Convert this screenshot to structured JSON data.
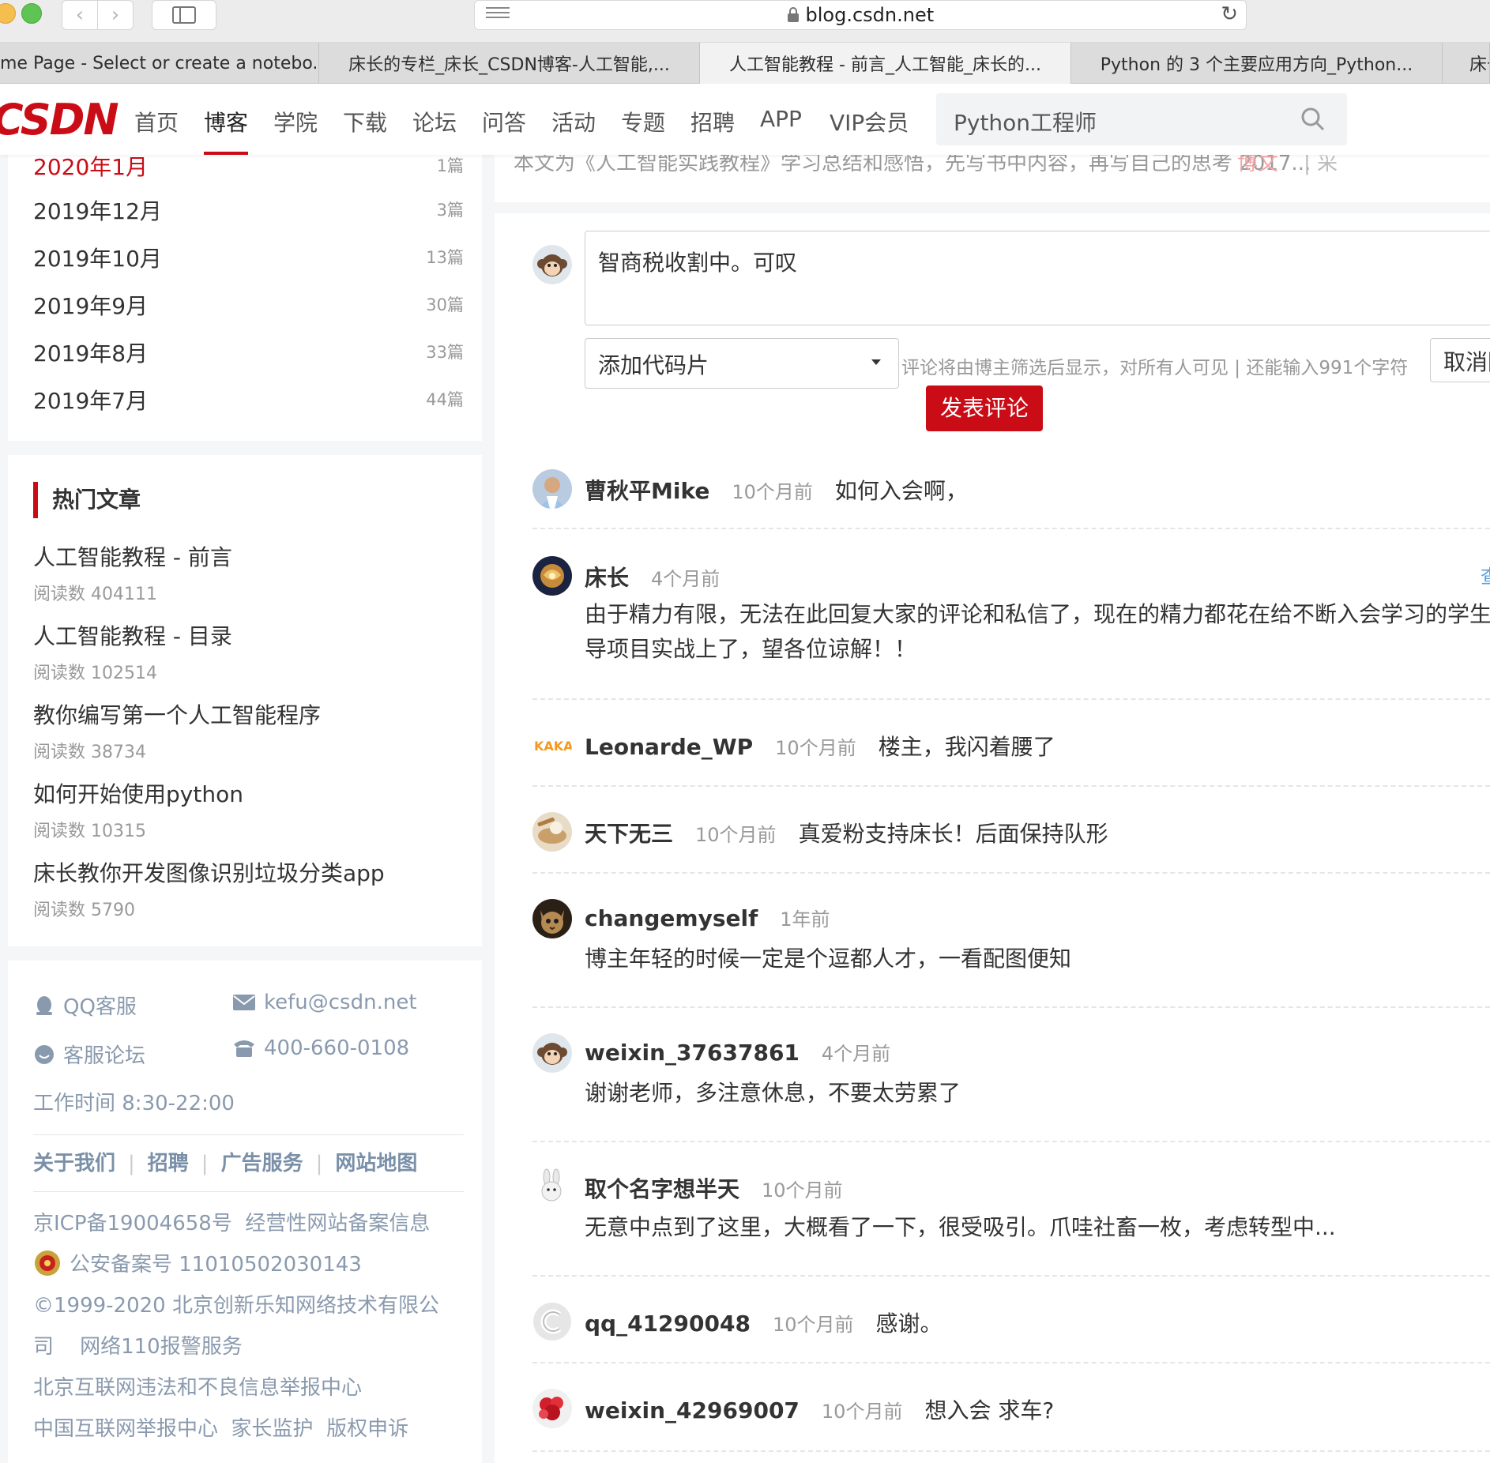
{
  "browser": {
    "url": "blog.csdn.net",
    "tabs": [
      "me Page - Select or create a notebo...",
      "床长的专栏_床长_CSDN博客-人工智能,...",
      "人工智能教程 - 前言_人工智能_床长的...",
      "Python 的 3 个主要应用方向_Python...",
      "床长"
    ]
  },
  "header": {
    "logo": "CSDN",
    "nav": [
      "首页",
      "博客",
      "学院",
      "下载",
      "论坛",
      "问答",
      "活动",
      "专题",
      "招聘",
      "APP",
      "VIP会员"
    ],
    "active_nav": "博客",
    "search_value": "Python工程师"
  },
  "archive": [
    {
      "month": "2020年1月",
      "count": "1篇"
    },
    {
      "month": "2019年12月",
      "count": "3篇"
    },
    {
      "month": "2019年10月",
      "count": "13篇"
    },
    {
      "month": "2019年9月",
      "count": "30篇"
    },
    {
      "month": "2019年8月",
      "count": "33篇"
    },
    {
      "month": "2019年7月",
      "count": "44篇"
    }
  ],
  "hot": {
    "title": "热门文章",
    "items": [
      {
        "title": "人工智能教程 - 前言",
        "reads": "阅读数 404111"
      },
      {
        "title": "人工智能教程 - 目录",
        "reads": "阅读数 102514"
      },
      {
        "title": "教你编写第一个人工智能程序",
        "reads": "阅读数 38734"
      },
      {
        "title": "如何开始使用python",
        "reads": "阅读数 10315"
      },
      {
        "title": "床长教你开发图像识别垃圾分类app",
        "reads": "阅读数 5790"
      }
    ]
  },
  "footer": {
    "qq": "QQ客服",
    "email": "kefu@csdn.net",
    "forum": "客服论坛",
    "phone": "400-660-0108",
    "hours": "工作时间 8:30-22:00",
    "links": [
      "关于我们",
      "招聘",
      "广告服务",
      "网站地图"
    ],
    "icp": "京ICP备19004658号",
    "icp_info": "经营性网站备案信息",
    "police": "公安备案号 11010502030143",
    "copyright": "©1999-2020 北京创新乐知网络技术有限公",
    "copyright2": "司",
    "report110": "网络110报警服务",
    "report_bj": "北京互联网违法和不良信息举报中心",
    "report_cn": "中国互联网举报中心",
    "parent": "家长监护",
    "copyright_complaint": "版权申诉"
  },
  "article": {
    "excerpt": "本文为《人工智能实践教程》学习总结和感悟，先写书中内容，再写自己的思考 2017...",
    "tag": "博文",
    "tag2": "|  采"
  },
  "comment_form": {
    "text": "智商税收割中。可叹",
    "code_select": "添加代码片",
    "hint": "评论将由博主筛选后显示，对所有人可见 | 还能输入991个字符",
    "cancel": "取消回复",
    "submit": "发表评论"
  },
  "comments": [
    {
      "name": "曹秋平Mike",
      "time": "10个月前",
      "text": "如何入会啊，"
    },
    {
      "name": "床长",
      "time": "4个月前",
      "view": "查",
      "body1": "由于精力有限，无法在此回复大家的评论和私信了，现在的精力都花在给不断入会学习的学生",
      "body2": "导项目实战上了，望各位谅解！！"
    },
    {
      "name": "Leonarde_WP",
      "time": "10个月前",
      "text": "楼主，我闪着腰了"
    },
    {
      "name": "天下无三",
      "time": "10个月前",
      "text": "真爱粉支持床长！后面保持队形"
    },
    {
      "name": "changemyself",
      "time": "1年前",
      "body1": "博主年轻的时候一定是个逗都人才，一看配图便知"
    },
    {
      "name": "weixin_37637861",
      "time": "4个月前",
      "body1": "谢谢老师，多注意休息，不要太劳累了"
    },
    {
      "name": "取个名字想半天",
      "time": "10个月前",
      "body1": "无意中点到了这里，大概看了一下，很受吸引。爪哇社畜一枚，考虑转型中..."
    },
    {
      "name": "qq_41290048",
      "time": "10个月前",
      "text": "感谢。"
    },
    {
      "name": "weixin_42969007",
      "time": "10个月前",
      "text": "想入会 求车?"
    }
  ],
  "colors": {
    "brand": "#ca0c16",
    "link": "#7a8fa8"
  }
}
